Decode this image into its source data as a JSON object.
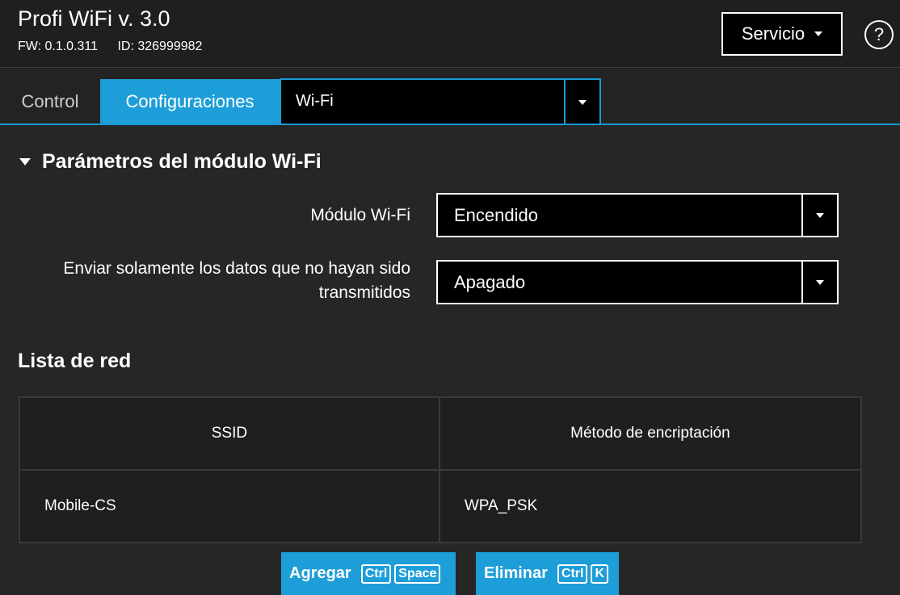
{
  "header": {
    "title": "Profi WiFi v. 3.0",
    "fw": "FW: 0.1.0.311",
    "id": "ID: 326999982",
    "service_label": "Servicio",
    "help_label": "?"
  },
  "tabs": {
    "control": "Control",
    "config": "Configuraciones",
    "submenu_value": "Wi-Fi"
  },
  "section": {
    "title": "Parámetros del módulo Wi-Fi",
    "fields": [
      {
        "label": "Módulo Wi-Fi",
        "value": "Encendido"
      },
      {
        "label_line1": "Enviar solamente los datos que no hayan sido",
        "label_line2": "transmitidos",
        "value": "Apagado"
      }
    ]
  },
  "network_list": {
    "title": "Lista de red",
    "columns": [
      "SSID",
      "Método de encriptación"
    ],
    "rows": [
      {
        "ssid": "Mobile-CS",
        "encryption": "WPA_PSK"
      }
    ]
  },
  "actions": {
    "add_label": "Agregar",
    "add_keys": [
      "Ctrl",
      "Space"
    ],
    "delete_label": "Eliminar",
    "delete_keys": [
      "Ctrl",
      "K"
    ]
  },
  "colors": {
    "accent": "#1e9ed8",
    "background": "#262626",
    "header_bg": "#1f1f1f"
  }
}
